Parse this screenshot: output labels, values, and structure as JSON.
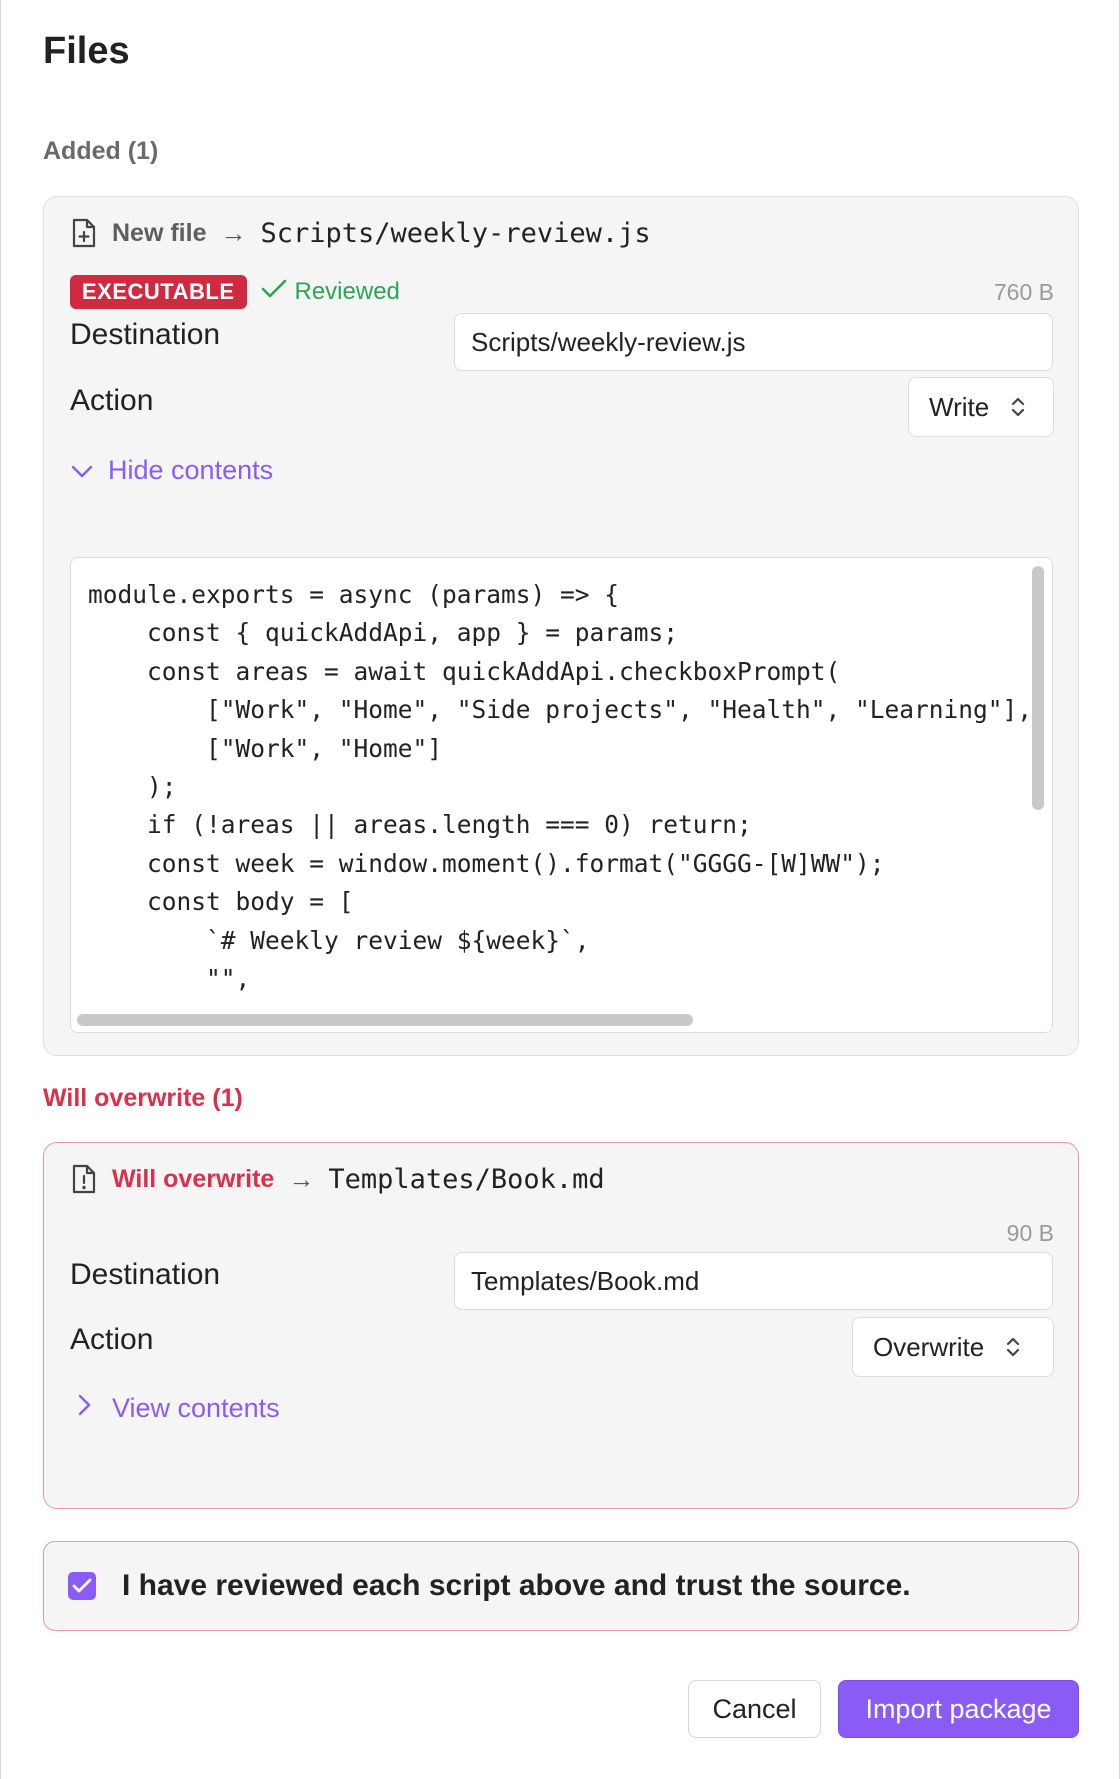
{
  "dialog": {
    "title": "Files"
  },
  "added": {
    "heading": "Added (1)",
    "file": {
      "kind": "New file",
      "path": "Scripts/weekly-review.js",
      "badge": "EXECUTABLE",
      "reviewed": "Reviewed",
      "size": "760 B",
      "destination_label": "Destination",
      "destination_value": "Scripts/weekly-review.js",
      "action_label": "Action",
      "action_value": "Write",
      "toggle_label": "Hide contents",
      "code": "module.exports = async (params) => {\n    const { quickAddApi, app } = params;\n    const areas = await quickAddApi.checkboxPrompt(\n        [\"Work\", \"Home\", \"Side projects\", \"Health\", \"Learning\"],\n        [\"Work\", \"Home\"]\n    );\n    if (!areas || areas.length === 0) return;\n    const week = window.moment().format(\"GGGG-[W]WW\");\n    const body = [\n        `# Weekly review ${week}`,\n        \"\",\n        ...areas.flatMap((area) => [`## ${area}`, \"- Wins:\"],"
    }
  },
  "overwrite": {
    "heading": "Will overwrite (1)",
    "file": {
      "kind": "Will overwrite",
      "path": "Templates/Book.md",
      "size": "90 B",
      "destination_label": "Destination",
      "destination_value": "Templates/Book.md",
      "action_label": "Action",
      "action_value": "Overwrite",
      "toggle_label": "View contents"
    }
  },
  "trust": {
    "label": "I have reviewed each script above and trust the source.",
    "checked": true
  },
  "footer": {
    "cancel_label": "Cancel",
    "import_label": "Import package"
  },
  "colors": {
    "accent": "#8a5cf5",
    "danger": "#d9304b",
    "success": "#2aa653"
  }
}
